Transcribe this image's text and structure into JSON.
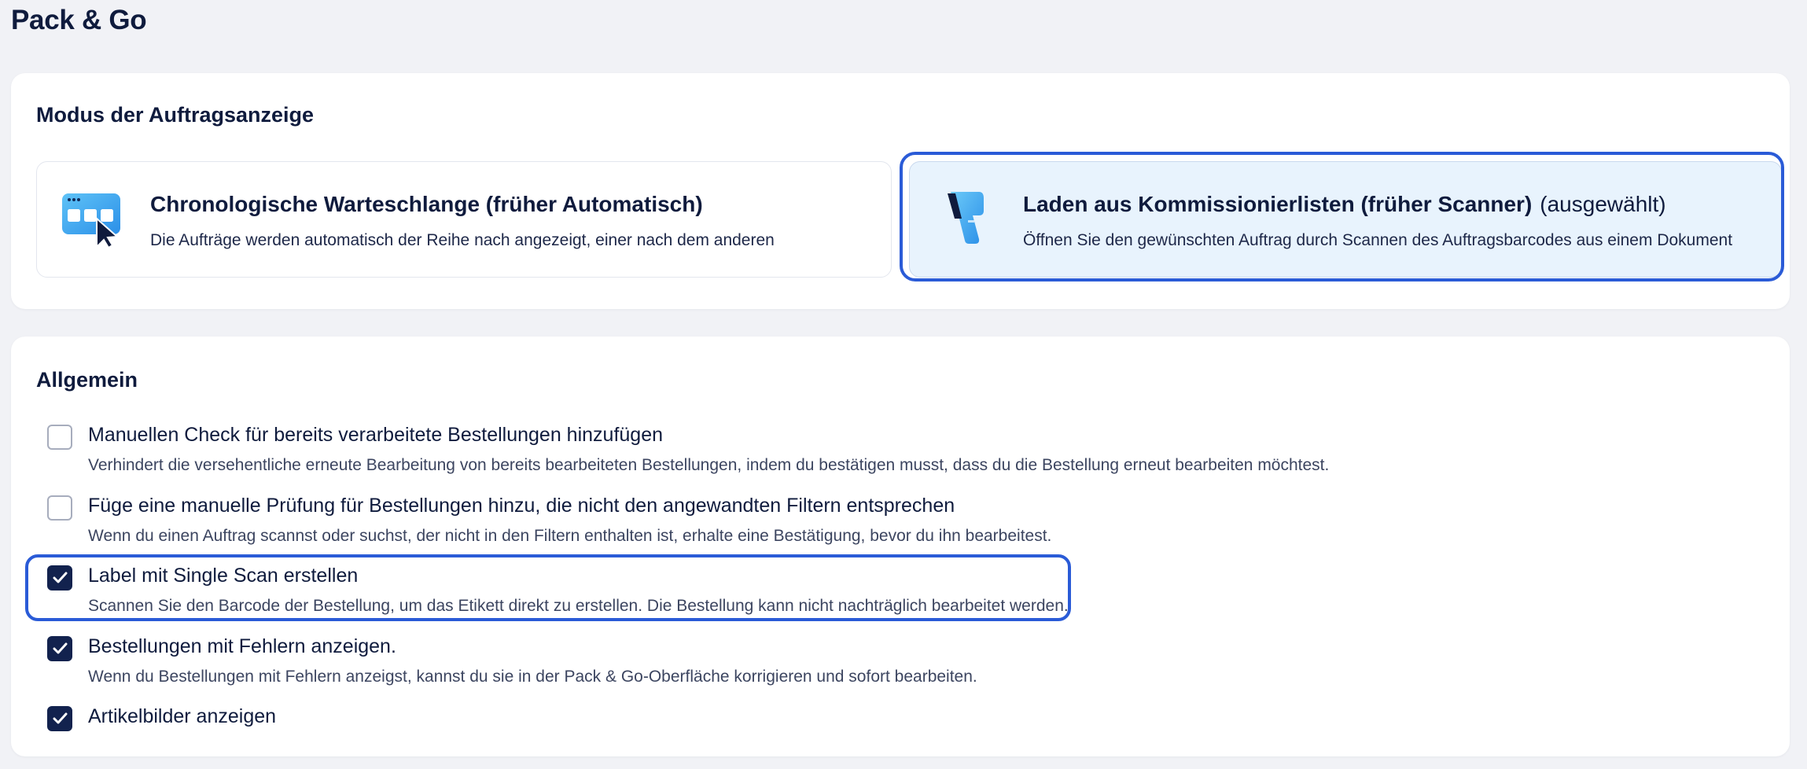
{
  "page": {
    "title": "Pack & Go"
  },
  "mode_section": {
    "title": "Modus der Auftragsanzeige",
    "options": [
      {
        "title": "Chronologische Warteschlange (früher Automatisch)",
        "description": "Die Aufträge werden automatisch der Reihe nach angezeigt, einer nach dem anderen",
        "icon": "queue-window-cursor-icon",
        "selected": false
      },
      {
        "title": "Laden aus Kommissionierlisten (früher Scanner)",
        "selected_tag": "(ausgewählt)",
        "description": "Öffnen Sie den gewünschten Auftrag durch Scannen des Auftragsbarcodes aus einem Dokument",
        "icon": "barcode-scanner-icon",
        "selected": true
      }
    ]
  },
  "general_section": {
    "title": "Allgemein",
    "settings": [
      {
        "label": "Manuellen Check für bereits verarbeitete Bestellungen hinzufügen",
        "description": "Verhindert die versehentliche erneute Bearbeitung von bereits bearbeiteten Bestellungen, indem du bestätigen musst, dass du die Bestellung erneut bearbeiten möchtest.",
        "checked": false
      },
      {
        "label": "Füge eine manuelle Prüfung für Bestellungen hinzu, die nicht den angewandten Filtern entsprechen",
        "description": "Wenn du einen Auftrag scannst oder suchst, der nicht in den Filtern enthalten ist, erhalte eine Bestätigung, bevor du ihn bearbeitest.",
        "checked": false
      },
      {
        "label": "Label mit Single Scan erstellen",
        "description": "Scannen Sie den Barcode der Bestellung, um das Etikett direkt zu erstellen. Die Bestellung kann nicht nachträglich bearbeitet werden.",
        "checked": true,
        "focused": true
      },
      {
        "label": "Bestellungen mit Fehlern anzeigen.",
        "description": "Wenn du Bestellungen mit Fehlern anzeigst, kannst du sie in der Pack & Go-Oberfläche korrigieren und sofort bearbeiten.",
        "checked": true
      },
      {
        "label": "Artikelbilder anzeigen",
        "description": "",
        "checked": true
      }
    ]
  },
  "colors": {
    "page_bg": "#f1f2f6",
    "text": "#0f1b3d",
    "accent_focus": "#2a5bd7",
    "selected_bg": "#e8f3fd",
    "checkbox_checked": "#12224e",
    "icon_blue": "#2d9bf0"
  }
}
